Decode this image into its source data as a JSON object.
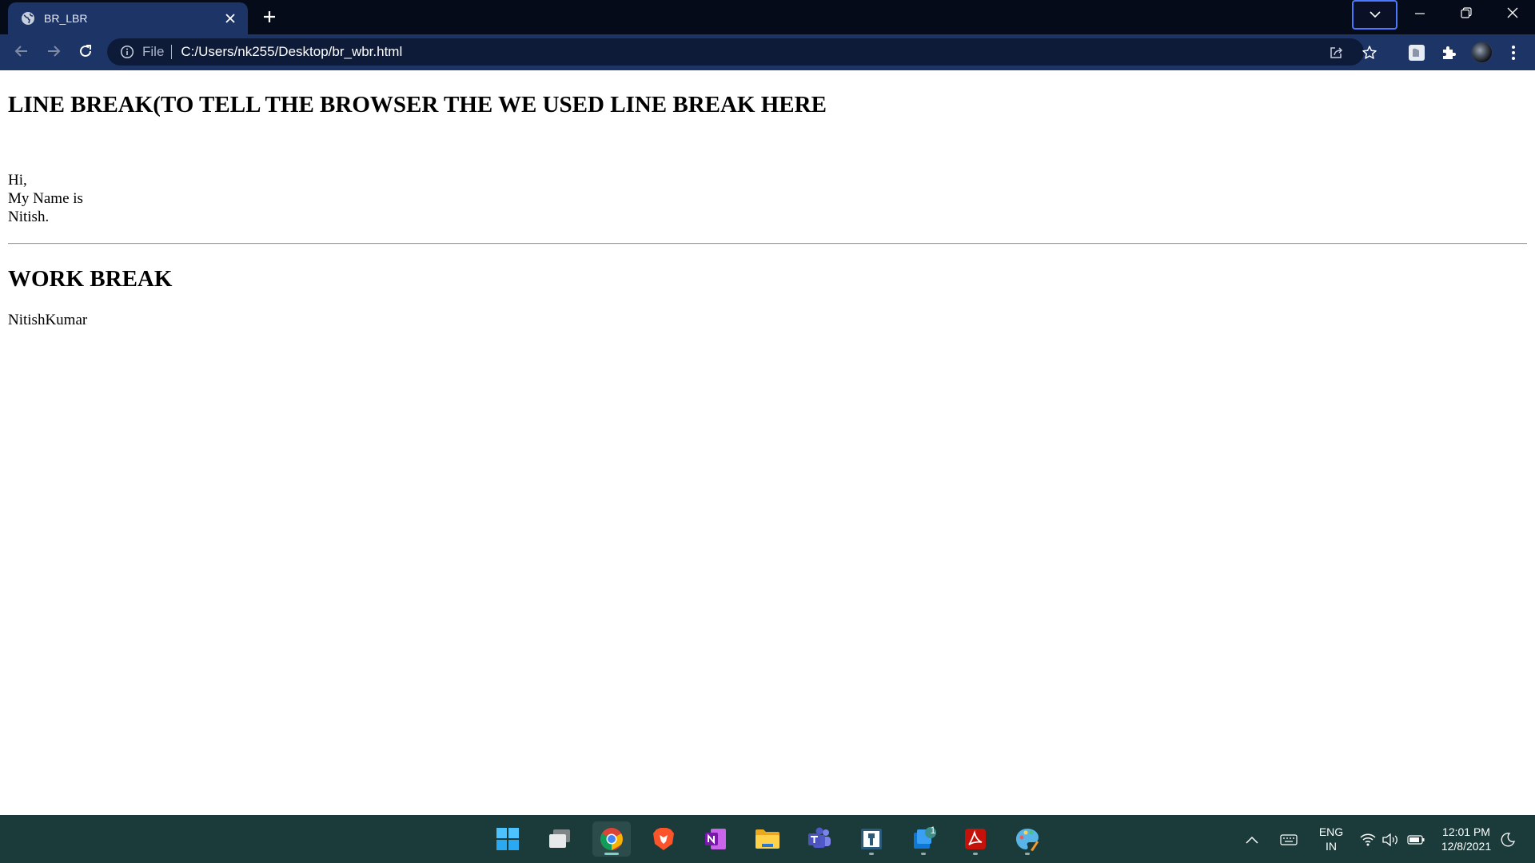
{
  "browser": {
    "tab": {
      "title": "BR_LBR",
      "favicon": "globe-icon"
    },
    "new_tab_icon": "plus-icon",
    "tab_search_icon": "chevron-down-icon",
    "window_controls": [
      "minimize-icon",
      "restore-icon",
      "close-icon"
    ],
    "address_bar": {
      "scheme_label": "File",
      "url": "C:/Users/nk255/Desktop/br_wbr.html"
    }
  },
  "page": {
    "heading1": "LINE BREAK(TO TELL THE BROWSER THE WE USED LINE BREAK HERE",
    "lines": [
      "Hi,",
      "My Name is",
      "Nitish."
    ],
    "heading2": "WORK BREAK",
    "wbr_text": "NitishKumar"
  },
  "taskbar": {
    "apps": [
      "windows-start",
      "task-view",
      "chrome",
      "brave",
      "onenote",
      "file-explorer",
      "teams",
      "openvpn",
      "mail",
      "acrobat",
      "paint"
    ],
    "mail_badge": "1",
    "language": {
      "line1": "ENG",
      "line2": "IN"
    },
    "clock": {
      "time": "12:01 PM",
      "date": "12/8/2021"
    }
  },
  "colors": {
    "titlebar": "#060b1a",
    "toolbar": "#1c3466",
    "taskbar": "#1b3b3a"
  }
}
